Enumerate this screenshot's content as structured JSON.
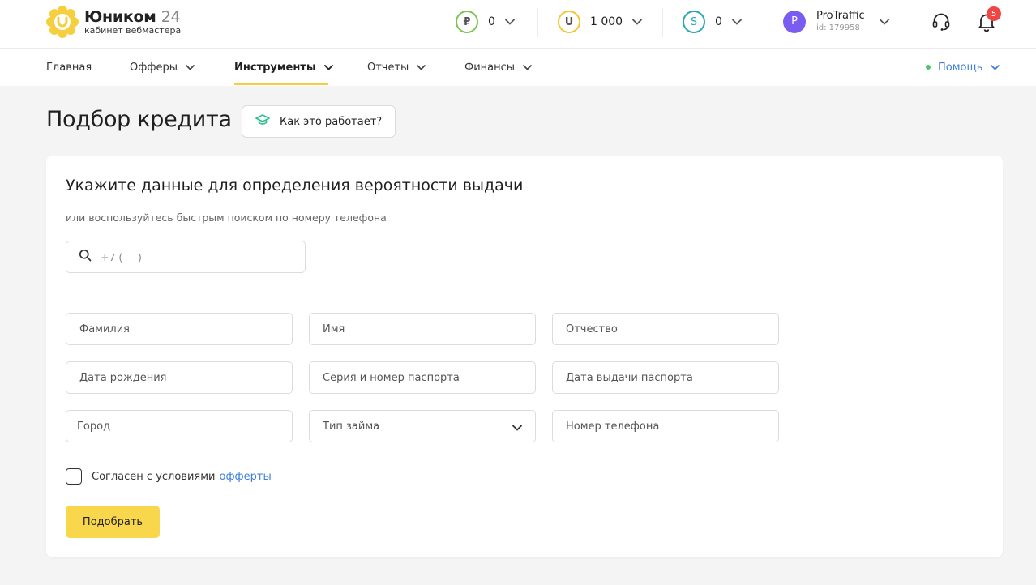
{
  "brand": {
    "name": "Юником",
    "number": "24",
    "subtitle": "кабинет вебмастера"
  },
  "balances": [
    {
      "symbol": "₽",
      "value": "0",
      "color": "#7cc44e",
      "icon": "ruble-coin-icon"
    },
    {
      "symbol": "U",
      "value": "1 000",
      "color": "#f2c735",
      "icon": "u-coin-icon"
    },
    {
      "symbol": "S",
      "value": "0",
      "color": "#2aa8b5",
      "icon": "s-coin-icon"
    }
  ],
  "user": {
    "initial": "P",
    "name": "ProTraffic",
    "id_label": "id: 179958",
    "avatar_color": "#7b5cf0"
  },
  "notifications": {
    "count": "5"
  },
  "nav": {
    "items": [
      {
        "label": "Главная",
        "has_dropdown": false
      },
      {
        "label": "Офферы",
        "has_dropdown": true
      },
      {
        "label": "Инструменты",
        "has_dropdown": true,
        "active": true
      },
      {
        "label": "Отчеты",
        "has_dropdown": true
      },
      {
        "label": "Финансы",
        "has_dropdown": true
      }
    ],
    "help_label": "Помощь"
  },
  "page": {
    "title": "Подбор кредита",
    "how_it_works_label": "Как это работает?"
  },
  "form": {
    "title": "Укажите данные для определения вероятности выдачи",
    "subtitle": "или воспользуйтесь быстрым поиском по номеру телефона",
    "phone_search_placeholder": "+7 (___) ___ - __ - __",
    "fields": {
      "last_name": "Фамилия",
      "first_name": "Имя",
      "middle_name": "Отчество",
      "birth_date": "Дата рождения",
      "passport_number": "Серия и номер паспорта",
      "passport_date": "Дата выдачи паспорта",
      "city": "Город",
      "loan_type": "Тип займа",
      "phone": "Номер телефона"
    },
    "agree_text": "Согласен с условиями",
    "agree_link": "офферты",
    "submit_label": "Подобрать"
  },
  "colors": {
    "accent_yellow": "#f6cf3e",
    "button_yellow": "#f8d74c",
    "link_blue": "#3f7fd9",
    "badge_red": "#f04545"
  }
}
